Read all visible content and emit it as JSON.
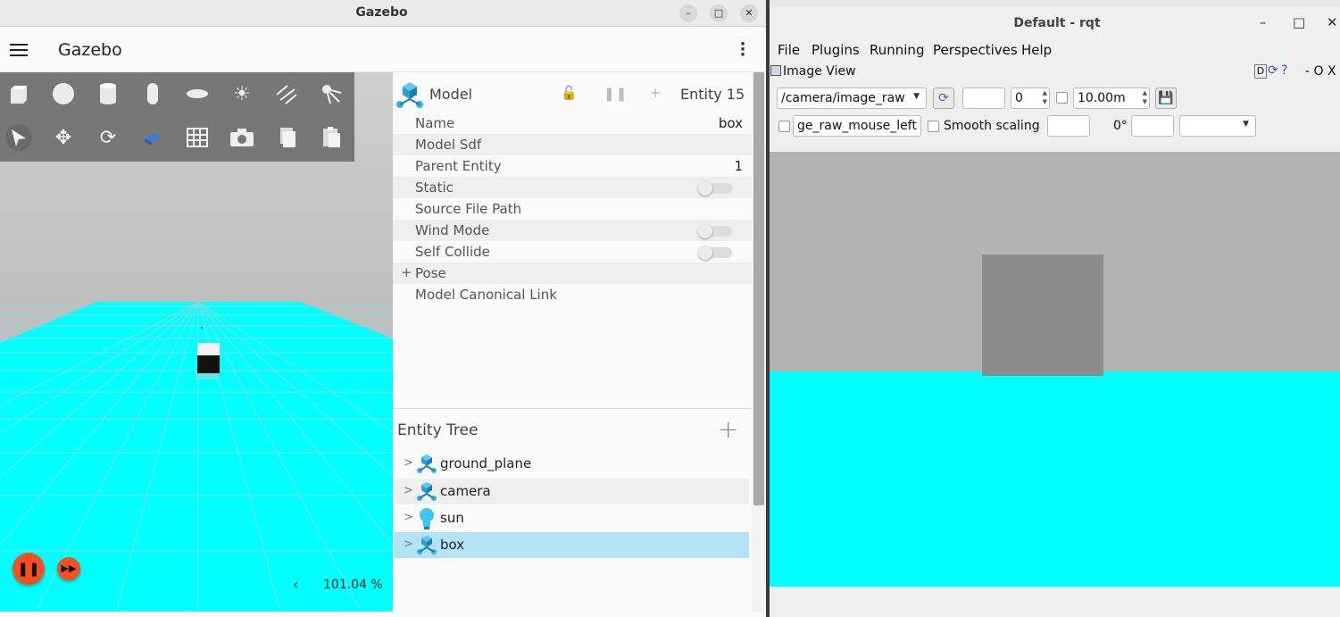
{
  "gazebo": {
    "window_title": "Gazebo",
    "app_name": "Gazebo",
    "window_buttons": [
      "–",
      "□",
      "✕"
    ],
    "toolbar_row1": [
      "box-icon",
      "sphere-icon",
      "cylinder-icon",
      "capsule-icon",
      "ellipsoid-icon",
      "sun-light-icon",
      "directional-light-icon",
      "spot-light-icon"
    ],
    "toolbar_row2": [
      "select-icon",
      "translate-icon",
      "rotate-icon",
      "transform-icon",
      "grid-snap-icon",
      "screenshot-icon",
      "copy-icon",
      "paste-icon"
    ],
    "component_inspector": {
      "title": "Model",
      "entity_label": "Entity 15",
      "rows": [
        {
          "label": "Name",
          "value": "box"
        },
        {
          "label": "Model Sdf",
          "value": ""
        },
        {
          "label": "Parent Entity",
          "value": "1"
        },
        {
          "label": "Static",
          "toggle": false
        },
        {
          "label": "Source File Path",
          "value": ""
        },
        {
          "label": "Wind Mode",
          "toggle": false
        },
        {
          "label": "Self Collide",
          "toggle": false
        },
        {
          "label": "Pose",
          "expandable": true
        },
        {
          "label": "Model Canonical Link",
          "value": ""
        }
      ]
    },
    "entity_tree": {
      "title": "Entity Tree",
      "add": "+",
      "items": [
        {
          "label": "ground_plane",
          "icon": "model-icon"
        },
        {
          "label": "camera",
          "icon": "model-icon"
        },
        {
          "label": "sun",
          "icon": "light-icon"
        },
        {
          "label": "box",
          "icon": "model-icon",
          "selected": true
        }
      ]
    },
    "rtf": "101.04 %",
    "rtf_arrow": "‹",
    "ground_color": "#00ffff",
    "accent_color": "#f4511e"
  },
  "rqt": {
    "window_title": "Default - rqt",
    "window_buttons": [
      "–",
      "□",
      "✕"
    ],
    "menu": [
      "File",
      "Plugins",
      "Running",
      "Perspectives",
      "Help"
    ],
    "plugin_title": "Image View",
    "plugin_controls": "- O X",
    "plugin_badge": "D",
    "topic": "/camera/image_raw",
    "number_value": "0",
    "distance_value": "10.00m",
    "mouse_topic": "ge_raw_mouse_left",
    "smooth_scaling_label": "Smooth scaling",
    "rotation_label": "0°",
    "image": {
      "sky_color": "#b3b3b3",
      "ground_color": "#00ffff",
      "box_color": "#8c8c8c"
    }
  }
}
